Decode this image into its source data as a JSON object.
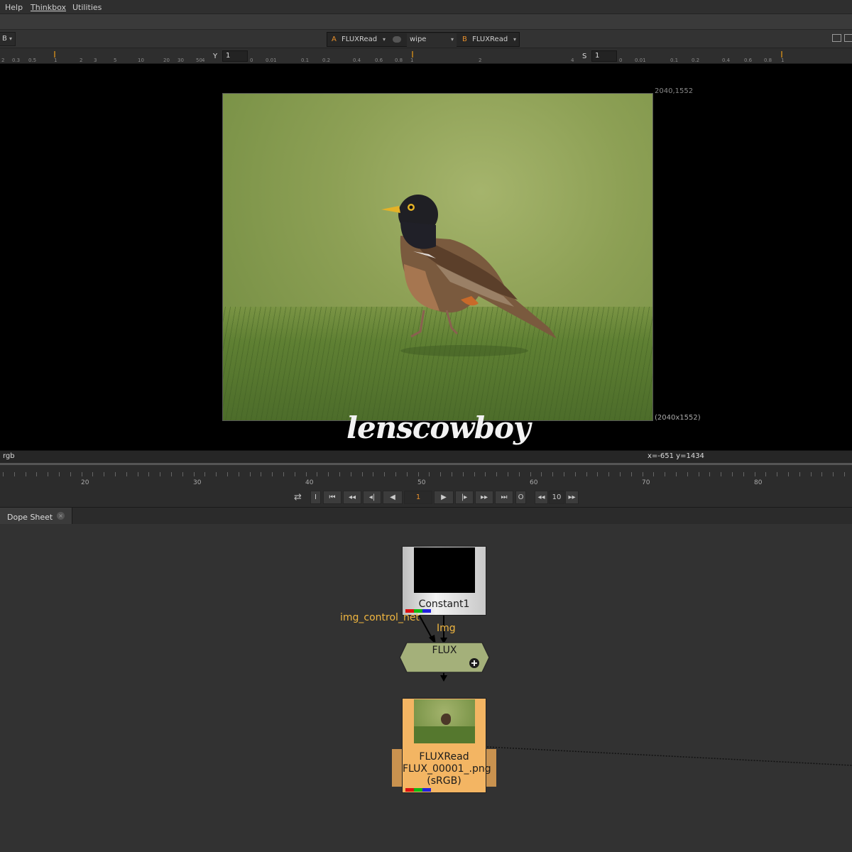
{
  "menu": {
    "help": "Help",
    "thinkbox": "Thinkbox",
    "utilities": "Utilities"
  },
  "toolbar": {
    "channel": "B",
    "input_a_tag": "A",
    "input_a": "FLUXRead",
    "wipe_mode": "wipe",
    "input_b_tag": "B",
    "input_b": "FLUXRead"
  },
  "ruler": {
    "left_ticks": [
      "2",
      "0.3",
      "0.5",
      "1",
      "2",
      "3",
      "5",
      "10",
      "20",
      "30",
      "50",
      "4"
    ],
    "y_label": "Y",
    "y_value": "1",
    "mid_ticks": [
      "0",
      "0.01",
      "0.1",
      "0.2",
      "0.4",
      "0.6",
      "0.8",
      "1",
      "2",
      "4"
    ],
    "s_label": "S",
    "s_value": "1",
    "right_ticks": [
      "0",
      "0.01",
      "0.1",
      "0.2",
      "0.4",
      "0.6",
      "0.8",
      "1"
    ]
  },
  "viewer": {
    "format_corner": "2040,1552",
    "format_size": "(2040x1552)",
    "watermark": "lenscowboy"
  },
  "status": {
    "channels": "rgb",
    "coords": "x=-651 y=1434"
  },
  "timeline": {
    "frame_numbers": [
      "20",
      "30",
      "40",
      "50",
      "60",
      "70",
      "80"
    ],
    "in_btn": "I",
    "current_frame": "1",
    "out_btn": "O",
    "step": "10"
  },
  "panel": {
    "tab_label": "Dope Sheet",
    "close": "×"
  },
  "nodes": {
    "constant": "Constant1",
    "edge_left": "img_control_net",
    "edge_right": "Img",
    "flux": "FLUX",
    "read_name": "FLUXRead",
    "read_file": "FLUX_00001_.png",
    "read_space": "(sRGB)"
  },
  "colors": {
    "accent_orange": "#e8902c",
    "read_node": "#f3b563",
    "flux_node": "#a4b07a",
    "edge_label": "#f0b640"
  }
}
